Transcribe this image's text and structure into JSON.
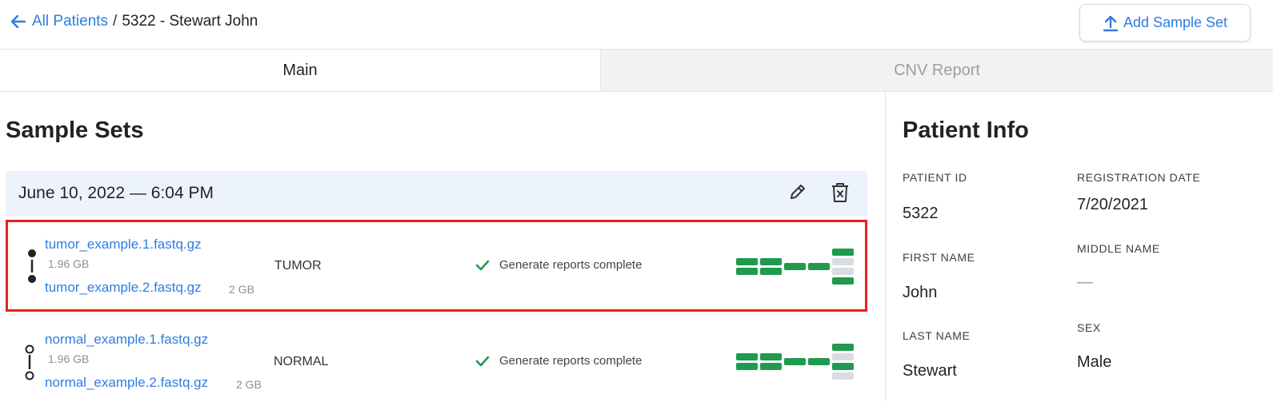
{
  "header": {
    "back_label": "All Patients",
    "separator": "/",
    "current": "5322 - Stewart John",
    "add_button": "Add Sample Set"
  },
  "tabs": [
    {
      "label": "Main",
      "active": true
    },
    {
      "label": "CNV Report",
      "active": false
    }
  ],
  "sample_sets": {
    "title": "Sample Sets",
    "sets": [
      {
        "date": "June 10, 2022 — 6:04 PM",
        "samples": [
          {
            "file1": "tumor_example.1.fastq.gz",
            "file1_size": "1.96 GB",
            "file2": "tumor_example.2.fastq.gz",
            "file2_size": "2 GB",
            "type": "TUMOR",
            "status": "Generate reports complete",
            "selected": true
          },
          {
            "file1": "normal_example.1.fastq.gz",
            "file1_size": "1.96 GB",
            "file2": "normal_example.2.fastq.gz",
            "file2_size": "2 GB",
            "type": "NORMAL",
            "status": "Generate reports complete",
            "selected": false
          }
        ]
      }
    ]
  },
  "patient_info": {
    "title": "Patient Info",
    "patient_id_label": "PATIENT ID",
    "patient_id": "5322",
    "registration_date_label": "REGISTRATION DATE",
    "registration_date": "7/20/2021",
    "first_name_label": "FIRST NAME",
    "first_name": "John",
    "middle_name_label": "MIDDLE NAME",
    "middle_name": "—",
    "last_name_label": "LAST NAME",
    "last_name": "Stewart",
    "sex_label": "SEX",
    "sex": "Male"
  },
  "colors": {
    "accent": "#2f7de1",
    "success": "#1e9b4f",
    "pending": "#d9dde2",
    "highlight": "#e8201f",
    "set_header_bg": "#edf3fd"
  }
}
